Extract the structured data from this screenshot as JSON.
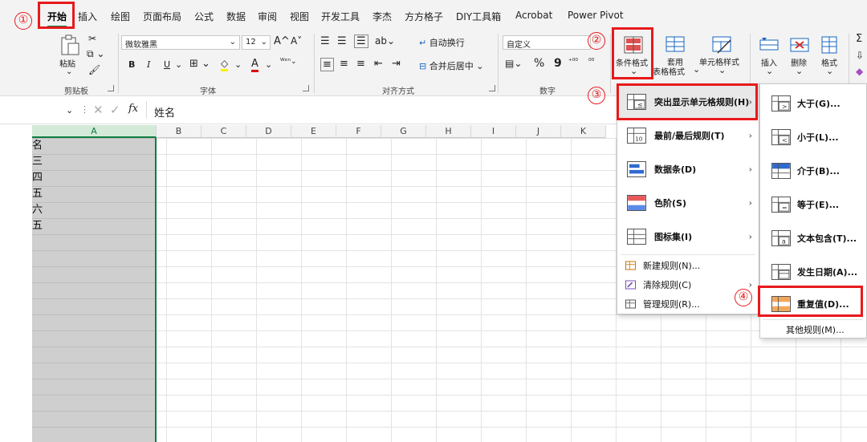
{
  "tabs": [
    "开始",
    "插入",
    "绘图",
    "页面布局",
    "公式",
    "数据",
    "审阅",
    "视图",
    "开发工具",
    "李杰",
    "方方格子",
    "DIY工具箱",
    "Acrobat",
    "Power Pivot"
  ],
  "ribbon": {
    "clipboard": {
      "paste": "粘贴",
      "label": "剪贴板"
    },
    "font": {
      "name": "微软雅黑",
      "size": "12",
      "bold": "B",
      "italic": "I",
      "underline": "U",
      "grow": "A^",
      "shrink": "A˅",
      "color_a": "A",
      "label": "字体"
    },
    "align": {
      "wrap": "自动换行",
      "merge": "合并后居中",
      "label": "对齐方式"
    },
    "number": {
      "format": "自定义",
      "percent": "%",
      "comma": "9",
      "label": "数字"
    },
    "styles": {
      "cond_format": "条件格式",
      "table_format_1": "套用",
      "table_format_2": "表格格式",
      "cell_style": "单元格样式"
    },
    "cells": {
      "insert": "插入",
      "delete": "删除",
      "format": "格式"
    }
  },
  "formula_bar": {
    "fx": "fx",
    "value": "姓名"
  },
  "columns": [
    "A",
    "B",
    "C",
    "D",
    "E",
    "F",
    "G",
    "H",
    "I",
    "J",
    "K"
  ],
  "cells": [
    "名",
    "三",
    "四",
    "五",
    "六",
    "五"
  ],
  "menu_main": {
    "items": [
      {
        "label": "突出显示单元格规则(H)"
      },
      {
        "label": "最前/最后规则(T)"
      },
      {
        "label": "数据条(D)"
      },
      {
        "label": "色阶(S)"
      },
      {
        "label": "图标集(I)"
      }
    ],
    "small_items": [
      {
        "label": "新建规则(N)..."
      },
      {
        "label": "清除规则(C)"
      },
      {
        "label": "管理规则(R)..."
      }
    ]
  },
  "menu_sub": {
    "items": [
      {
        "label": "大于(G)..."
      },
      {
        "label": "小于(L)..."
      },
      {
        "label": "介于(B)..."
      },
      {
        "label": "等于(E)..."
      },
      {
        "label": "文本包含(T)..."
      },
      {
        "label": "发生日期(A)..."
      },
      {
        "label": "重复值(D)..."
      }
    ],
    "other": "其他规则(M)..."
  },
  "annotations": [
    "①",
    "②",
    "③",
    "④"
  ],
  "colors": {
    "accent": "#107c41",
    "highlight": "#e8191c"
  }
}
